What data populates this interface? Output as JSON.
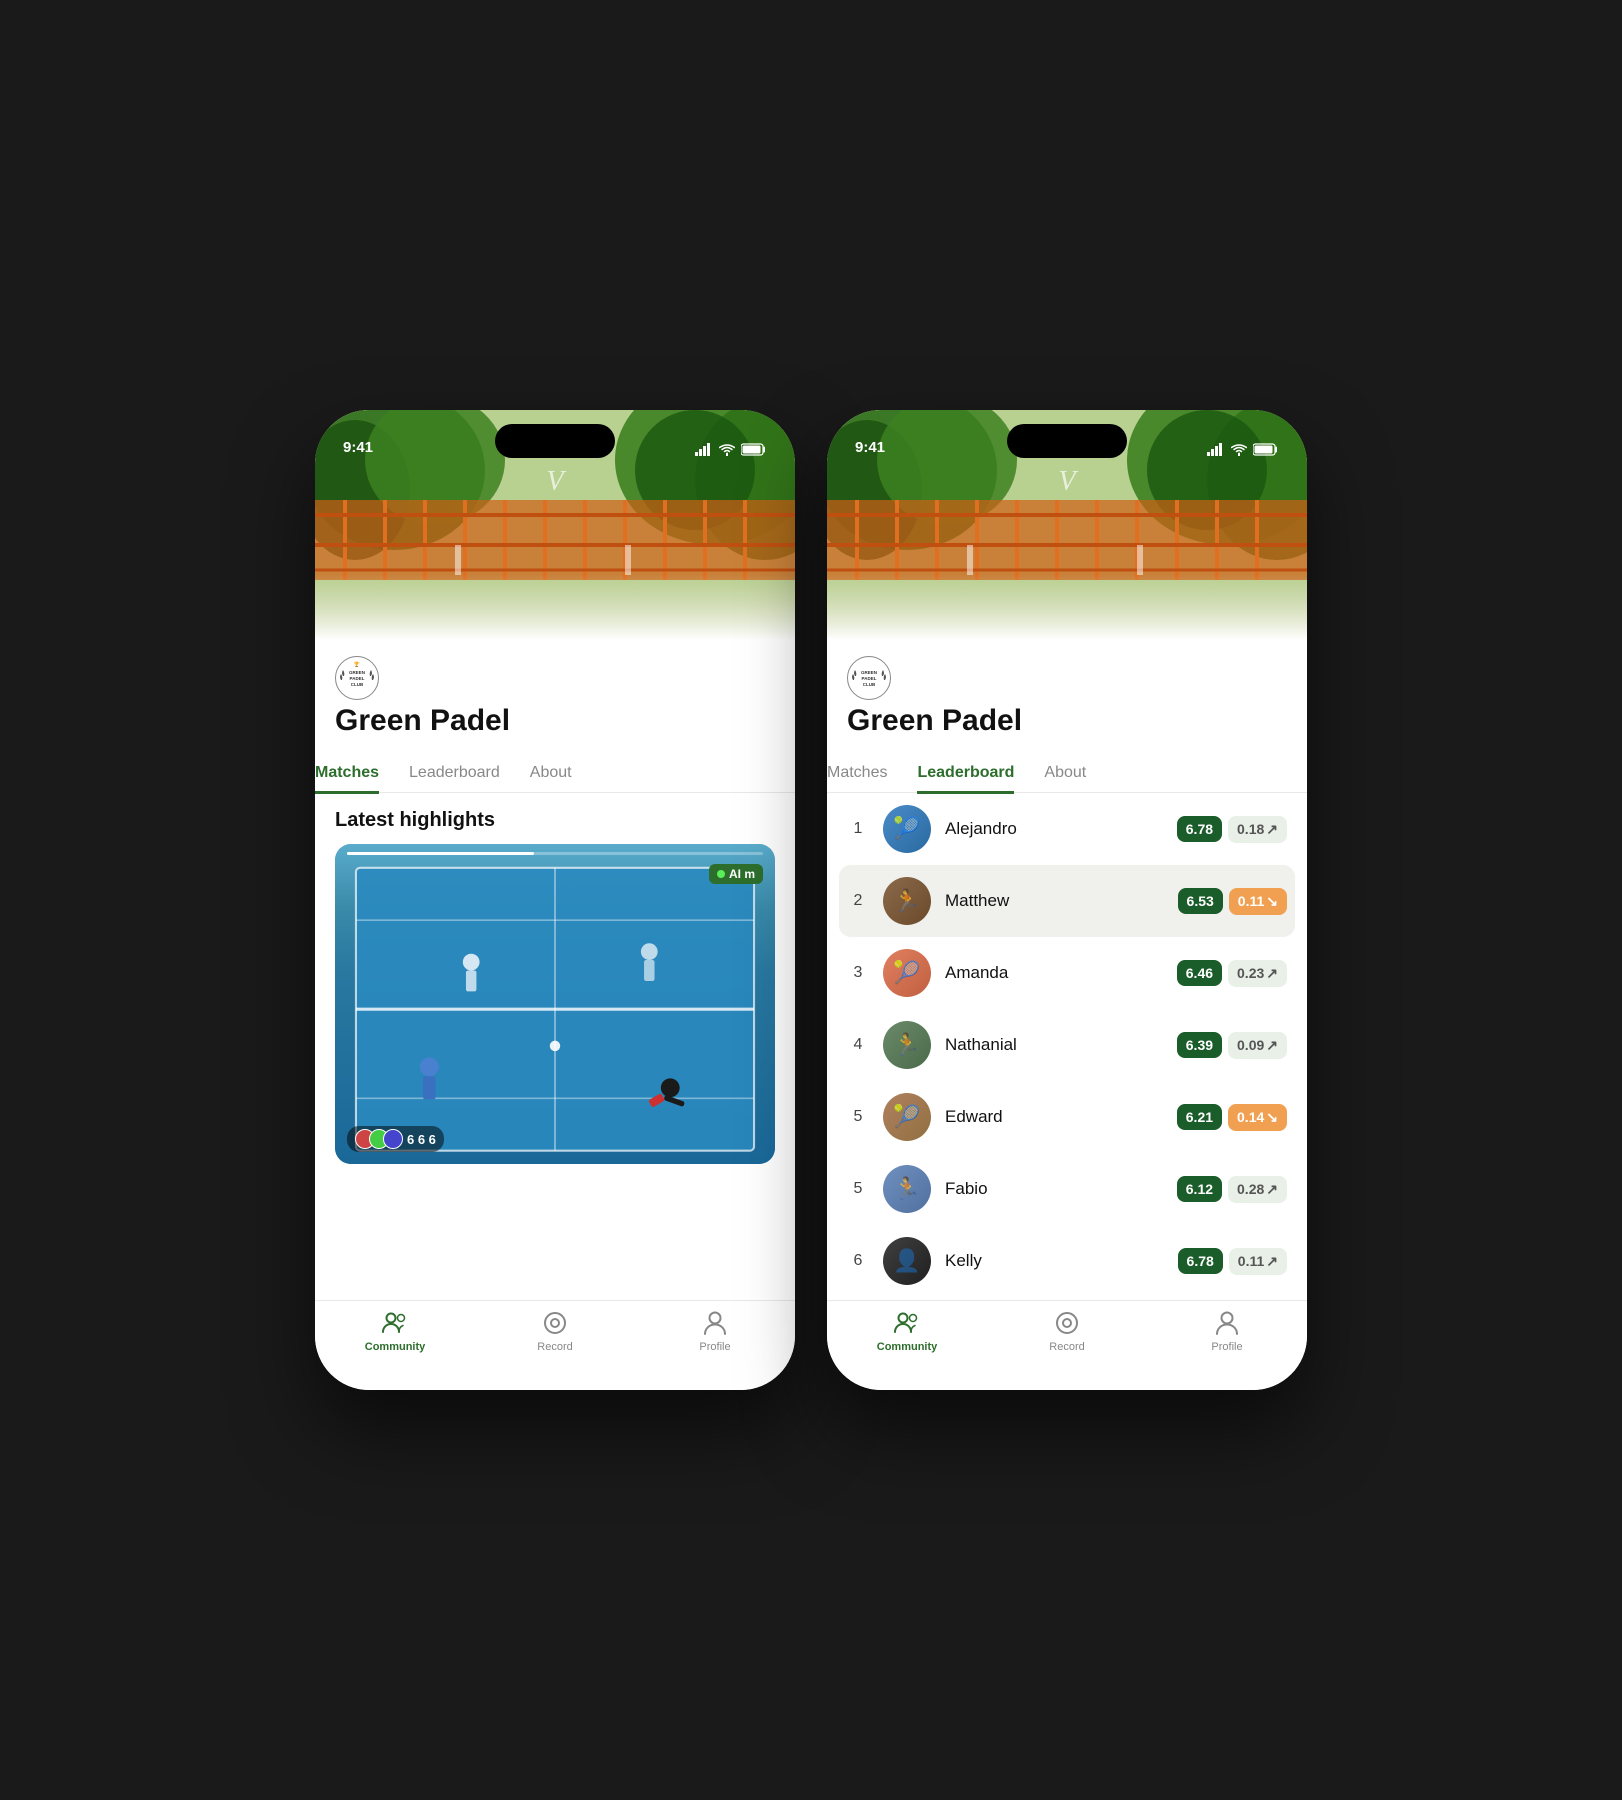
{
  "app": {
    "name": "Green Padel",
    "time": "9:41",
    "club_logo_text": "GREEN\nPADEL\nCLUB"
  },
  "phone_left": {
    "tab_active": "Matches",
    "tabs": [
      "Matches",
      "Leaderboard",
      "About"
    ],
    "section_title": "Latest highlights",
    "video": {
      "progress": "45%",
      "ai_label": "AI m",
      "viewer_count": "6 6 6"
    },
    "nav": {
      "items": [
        {
          "label": "Community",
          "icon": "community",
          "active": true
        },
        {
          "label": "Record",
          "icon": "record",
          "active": false
        },
        {
          "label": "Profile",
          "icon": "profile",
          "active": false
        }
      ]
    }
  },
  "phone_right": {
    "tab_active": "Leaderboard",
    "tabs": [
      "Matches",
      "Leaderboard",
      "About"
    ],
    "leaderboard": [
      {
        "rank": "1",
        "name": "Alejandro",
        "score": "6.78",
        "delta": "0.18",
        "delta_dir": "up",
        "highlighted": false
      },
      {
        "rank": "2",
        "name": "Matthew",
        "score": "6.53",
        "delta": "0.11",
        "delta_dir": "down",
        "highlighted": true
      },
      {
        "rank": "3",
        "name": "Amanda",
        "score": "6.46",
        "delta": "0.23",
        "delta_dir": "up",
        "highlighted": false
      },
      {
        "rank": "4",
        "name": "Nathanial",
        "score": "6.39",
        "delta": "0.09",
        "delta_dir": "up",
        "highlighted": false
      },
      {
        "rank": "5",
        "name": "Edward",
        "score": "6.21",
        "delta": "0.14",
        "delta_dir": "down",
        "highlighted": false
      },
      {
        "rank": "5",
        "name": "Fabio",
        "score": "6.12",
        "delta": "0.28",
        "delta_dir": "up",
        "highlighted": false
      },
      {
        "rank": "6",
        "name": "Kelly",
        "score": "6.78",
        "delta": "0.11",
        "delta_dir": "up",
        "highlighted": false
      }
    ],
    "nav": {
      "items": [
        {
          "label": "Community",
          "icon": "community",
          "active": true
        },
        {
          "label": "Record",
          "icon": "record",
          "active": false
        },
        {
          "label": "Profile",
          "icon": "profile",
          "active": false
        }
      ]
    }
  },
  "colors": {
    "green_dark": "#1a5c2a",
    "green_medium": "#2d6e2d",
    "green_tab": "#2d6e2d",
    "orange_delta": "#f0a050",
    "highlight_bg": "#f0f0ec"
  }
}
